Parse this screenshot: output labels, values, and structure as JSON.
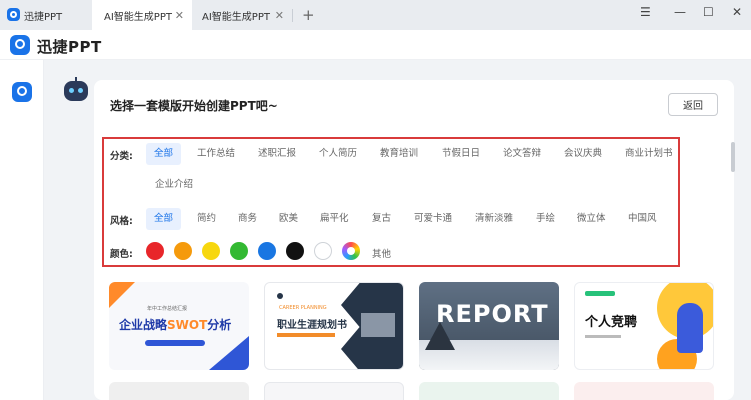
{
  "titlebar": {
    "tabs": [
      {
        "label": "迅捷PPT"
      },
      {
        "label": "AI智能生成PPT"
      },
      {
        "label": "AI智能生成PPT"
      }
    ],
    "close_glyph": "✕",
    "new_tab_glyph": "+",
    "window_controls": {
      "menu": "☰",
      "minimize": "—",
      "maximize": "☐",
      "close": "✕"
    }
  },
  "app": {
    "brand": "迅捷PPT",
    "brand_color": "#1a73e8"
  },
  "main": {
    "heading": "选择一套模版开始创建PPT吧~",
    "back_label": "返回"
  },
  "filters": {
    "category_label": "分类:",
    "categories": [
      "全部",
      "工作总结",
      "述职汇报",
      "个人简历",
      "教育培训",
      "节假日日",
      "论文答辩",
      "会议庆典",
      "商业计划书",
      "企业介绍"
    ],
    "style_label": "风格:",
    "styles": [
      "全部",
      "简约",
      "商务",
      "欧美",
      "扁平化",
      "复古",
      "可爱卡通",
      "清新淡雅",
      "手绘",
      "微立体",
      "中国风"
    ],
    "color_label": "颜色:",
    "colors": [
      "#e8262a",
      "#f59a0c",
      "#f7d70e",
      "#33b932",
      "#1976e2",
      "#111111",
      "#ffffff",
      "rainbow"
    ],
    "other_label": "其他",
    "active_color": "#1a73e8",
    "highlight_border": "#d93b3b"
  },
  "templates": [
    {
      "sub": "年中工作总结汇报",
      "title_pre": "企业战略",
      "title_hl": "SWOT",
      "title_post": "分析"
    },
    {
      "en": "CAREER PLANNING",
      "title": "职业生涯规划书"
    },
    {
      "title": "REPORT"
    },
    {
      "title": "个人竞聘"
    }
  ]
}
